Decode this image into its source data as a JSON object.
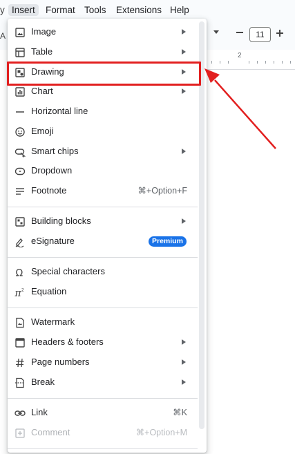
{
  "menubar": {
    "items": [
      {
        "label": "y"
      },
      {
        "label": "Insert"
      },
      {
        "label": "Format"
      },
      {
        "label": "Tools"
      },
      {
        "label": "Extensions"
      },
      {
        "label": "Help"
      }
    ]
  },
  "toolbar": {
    "left_glyph": "A",
    "font_size": "11"
  },
  "ruler": {
    "number": "2"
  },
  "menu": {
    "items": [
      {
        "label": "Image",
        "icon": "image-icon"
      },
      {
        "label": "Table",
        "icon": "table-icon"
      },
      {
        "label": "Drawing",
        "icon": "drawing-icon"
      },
      {
        "label": "Chart",
        "icon": "chart-icon"
      },
      {
        "label": "Horizontal line",
        "icon": "horizontal-line-icon"
      },
      {
        "label": "Emoji",
        "icon": "emoji-icon"
      },
      {
        "label": "Smart chips",
        "icon": "smart-chips-icon"
      },
      {
        "label": "Dropdown",
        "icon": "dropdown-icon"
      },
      {
        "label": "Footnote",
        "icon": "footnote-icon",
        "shortcut": "⌘+Option+F"
      },
      {
        "label": "Building blocks",
        "icon": "building-blocks-icon"
      },
      {
        "label": "eSignature",
        "icon": "esignature-icon",
        "badge": "Premium"
      },
      {
        "label": "Special characters",
        "icon": "omega-icon"
      },
      {
        "label": "Equation",
        "icon": "pi-icon"
      },
      {
        "label": "Watermark",
        "icon": "watermark-icon"
      },
      {
        "label": "Headers & footers",
        "icon": "headers-footers-icon"
      },
      {
        "label": "Page numbers",
        "icon": "hash-icon"
      },
      {
        "label": "Break",
        "icon": "break-icon"
      },
      {
        "label": "Link",
        "icon": "link-icon",
        "shortcut": "⌘K"
      },
      {
        "label": "Comment",
        "icon": "comment-icon",
        "shortcut": "⌘+Option+M",
        "disabled": true
      }
    ]
  },
  "colors": {
    "highlight": "#e21f1f",
    "premium_badge": "#1a73e8"
  }
}
